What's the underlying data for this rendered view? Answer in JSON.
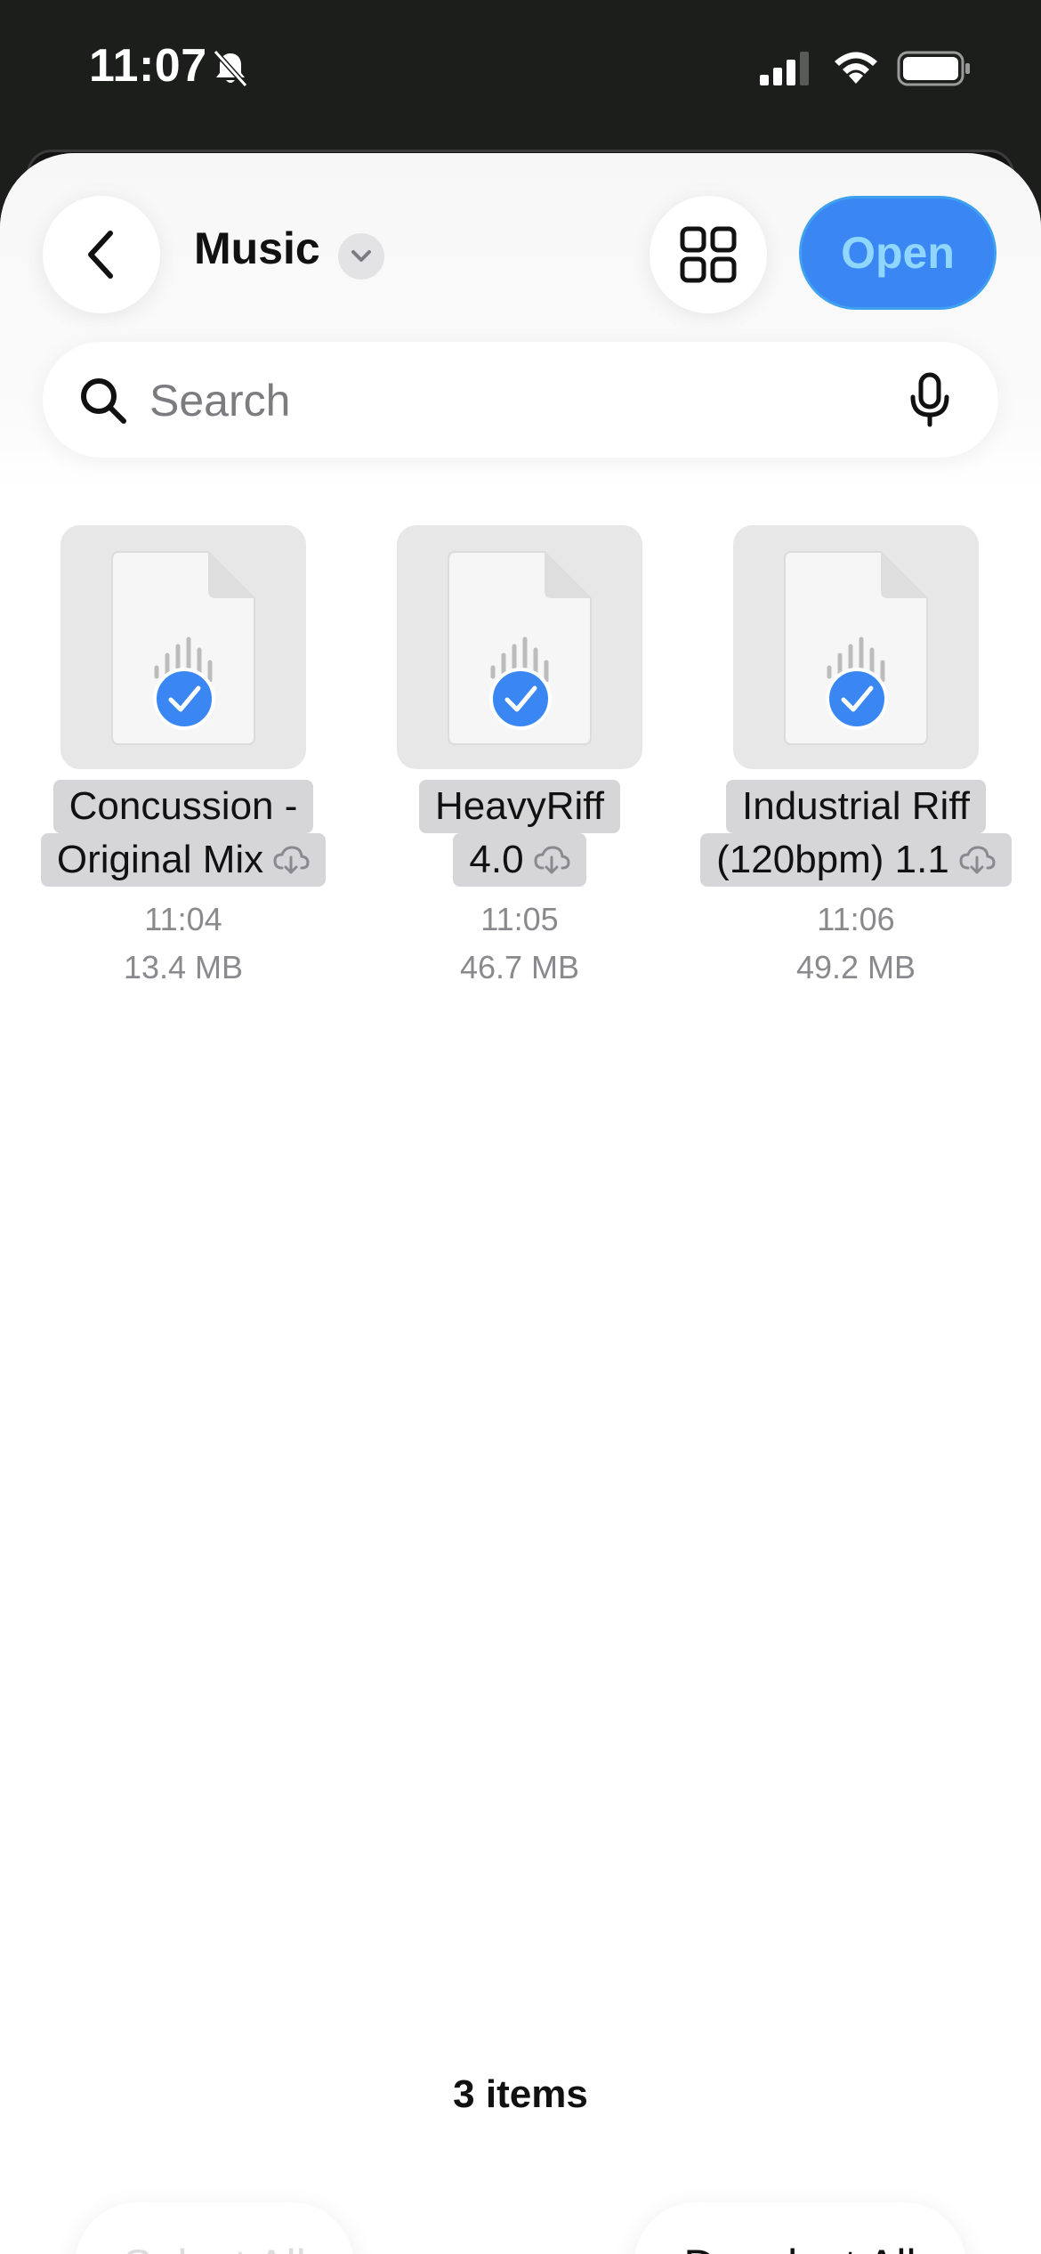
{
  "status_bar": {
    "time": "11:07"
  },
  "header": {
    "folder_title": "Music",
    "open_label": "Open"
  },
  "search": {
    "placeholder": "Search",
    "value": ""
  },
  "files": [
    {
      "name_line1": "Concussion -",
      "name_line2": "Original Mix",
      "time": "11:04",
      "size": "13.4 MB"
    },
    {
      "name_line1": "HeavyRiff",
      "name_line2": "4.0",
      "time": "11:05",
      "size": "46.7 MB"
    },
    {
      "name_line1": "Industrial Riff",
      "name_line2": "(120bpm) 1.1",
      "time": "11:06",
      "size": "49.2 MB"
    }
  ],
  "footer": {
    "items_count": "3 items",
    "select_all_label": "Select All",
    "deselect_all_label": "Deselect All"
  },
  "icons": {
    "back": "chevron-left-icon",
    "chevron": "chevron-down-icon",
    "grid": "grid-view-icon",
    "search": "search-icon",
    "mic": "microphone-icon",
    "file": "audio-file-icon",
    "check": "checkmark-circle-icon",
    "cloud": "cloud-download-icon"
  },
  "colors": {
    "accent": "#3a86f3",
    "open_text": "#8fd7ff",
    "status_bar_bg": "#1c1e1c"
  }
}
